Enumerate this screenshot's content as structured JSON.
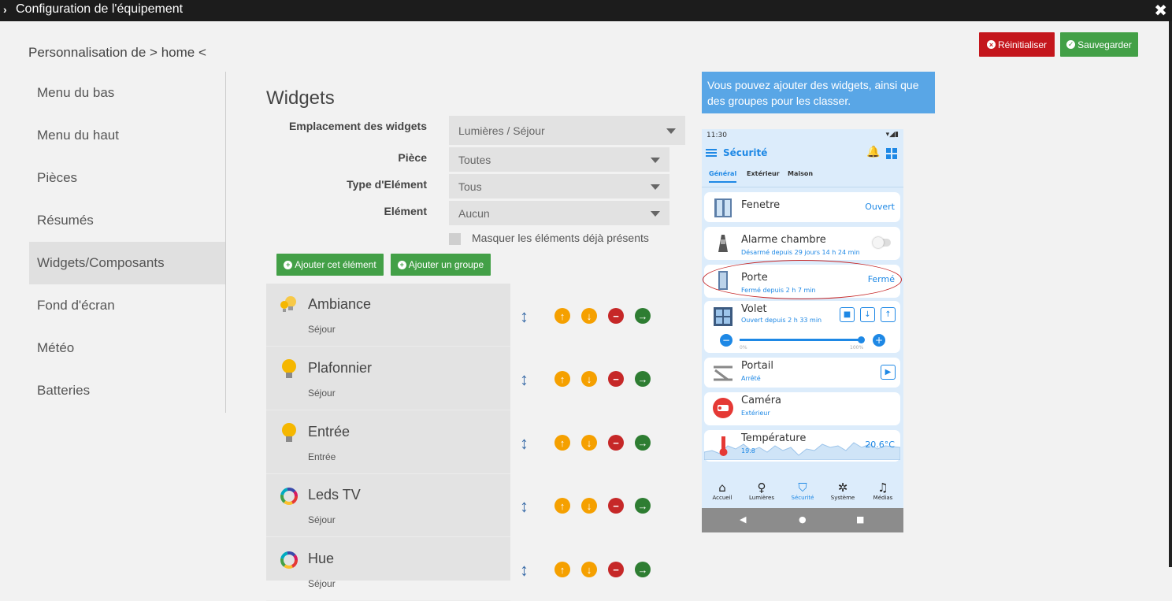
{
  "window": {
    "title": "Configuration de l'équipement",
    "close_glyph": "✖",
    "chevron_glyph": "›"
  },
  "toolbar": {
    "reset_label": "Réinitialiser",
    "save_label": "Sauvegarder"
  },
  "personalization": "Personnalisation de > home <",
  "sidebar": {
    "items": [
      {
        "label": "Menu du bas"
      },
      {
        "label": "Menu du haut"
      },
      {
        "label": "Pièces"
      },
      {
        "label": "Résumés"
      },
      {
        "label": "Widgets/Composants",
        "active": true
      },
      {
        "label": "Fond d'écran"
      },
      {
        "label": "Météo"
      },
      {
        "label": "Batteries"
      }
    ]
  },
  "widgets": {
    "heading": "Widgets",
    "fields": {
      "location": {
        "label": "Emplacement des widgets",
        "value": "Lumières / Séjour"
      },
      "room": {
        "label": "Pièce",
        "value": "Toutes"
      },
      "type": {
        "label": "Type d'Elément",
        "value": "Tous"
      },
      "element": {
        "label": "Elément",
        "value": "Aucun"
      }
    },
    "hide_present_label": "Masquer les éléments déjà présents",
    "add_element_label": "Ajouter cet élément",
    "add_group_label": "Ajouter un groupe",
    "items": [
      {
        "name": "Ambiance",
        "room": "Séjour",
        "icon": "bulbs-icon"
      },
      {
        "name": "Plafonnier",
        "room": "Séjour",
        "icon": "bulb-icon"
      },
      {
        "name": "Entrée",
        "room": "Entrée",
        "icon": "bulb-icon"
      },
      {
        "name": "Leds TV",
        "room": "Séjour",
        "icon": "color-ring-icon"
      },
      {
        "name": "Hue",
        "room": "Séjour",
        "icon": "color-ring-icon"
      }
    ],
    "action_glyphs": {
      "move": "↕",
      "up": "↑",
      "down": "↓",
      "remove": "−",
      "go": "→"
    }
  },
  "info": "Vous pouvez ajouter des widgets, ainsi que des groupes pour les classer.",
  "phone": {
    "time": "11:30",
    "status_icons": "▾◢▮",
    "title": "Sécurité",
    "tabs": [
      "Général",
      "Extérieur",
      "Maison"
    ],
    "cards": [
      {
        "name": "Fenetre",
        "state": "",
        "value": "Ouvert"
      },
      {
        "name": "Alarme chambre",
        "state": "Désarmé depuis 29 jours 14 h 24 min",
        "value": ""
      },
      {
        "name": "Porte",
        "state": "Fermé depuis 2 h 7 min",
        "value": "Fermé"
      },
      {
        "name": "Volet",
        "state": "Ouvert depuis 2 h 33 min",
        "value": "",
        "slider_min": "0%",
        "slider_max": "100%",
        "level": 1.0
      },
      {
        "name": "Portail",
        "state": "Arrêté",
        "value": ""
      },
      {
        "name": "Caméra",
        "state": "Extérieur",
        "value": ""
      },
      {
        "name": "Température",
        "state": "19.8",
        "value": "20.6°C"
      }
    ],
    "nav": [
      {
        "label": "Accueil",
        "glyph": "⌂"
      },
      {
        "label": "Lumières",
        "glyph": "♀"
      },
      {
        "label": "Sécurité",
        "glyph": "⛉"
      },
      {
        "label": "Système",
        "glyph": "✲"
      },
      {
        "label": "Médias",
        "glyph": "♫"
      }
    ],
    "sys_nav": [
      "◀",
      "●",
      "■"
    ]
  },
  "colors": {
    "accent": "#1e88e5",
    "danger": "#c4161c",
    "success": "#43a047",
    "warning": "#f5a000",
    "info_bg": "#59a6e6"
  }
}
